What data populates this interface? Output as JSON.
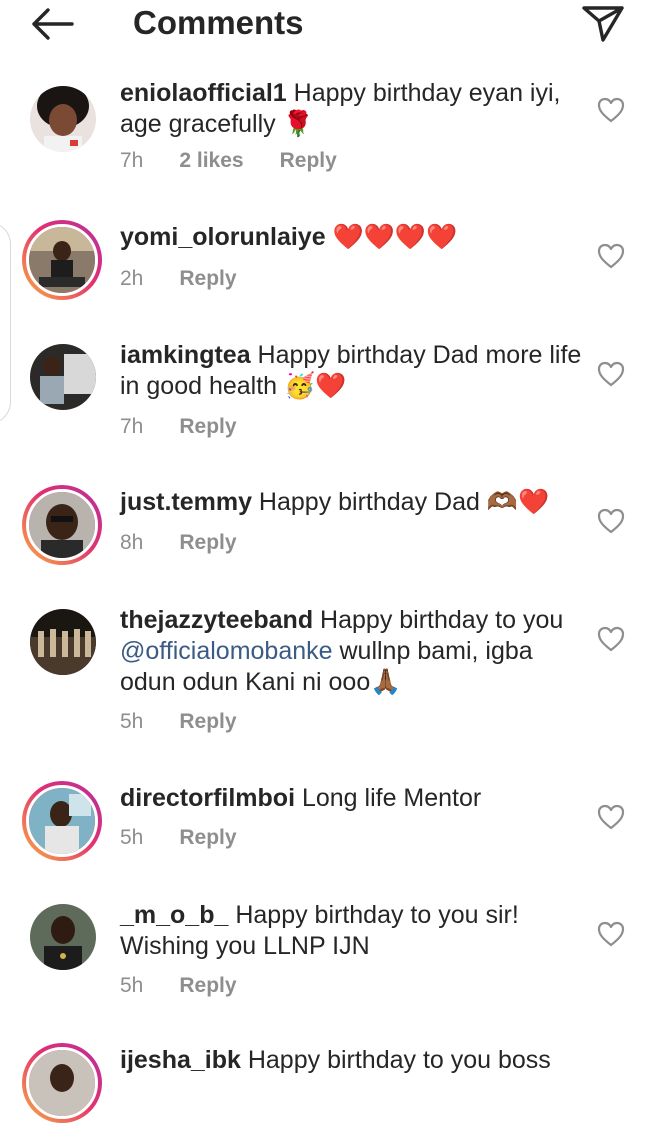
{
  "header": {
    "title": "Comments",
    "back_icon": "arrow-left-icon",
    "send_icon": "paper-plane-icon"
  },
  "comments": [
    {
      "username": "eniolaofficial1",
      "text": " Happy birthday eyan iyi, age gracefully 🌹",
      "time": "7h",
      "likes": "2 likes",
      "reply": "Reply",
      "story_ring": false
    },
    {
      "username": "yomi_olorunlaiye",
      "text": " ❤️❤️❤️❤️",
      "time": "2h",
      "reply": "Reply",
      "story_ring": true
    },
    {
      "username": "iamkingtea",
      "text": " Happy birthday Dad more life in good health 🥳❤️",
      "time": "7h",
      "reply": "Reply",
      "story_ring": false
    },
    {
      "username": "just.temmy",
      "text": " Happy birthday Dad 🫶🏾❤️",
      "time": "8h",
      "reply": "Reply",
      "story_ring": true
    },
    {
      "username": "thejazzyteeband",
      "text": " Happy birthday to you ",
      "mention": "@officialomobanke",
      "text_after": " wullnp bami, igba odun odun Kani ni ooo🙏🏾",
      "time": "5h",
      "reply": "Reply",
      "story_ring": false
    },
    {
      "username": "directorfilmboi",
      "text": " Long life Mentor",
      "time": "5h",
      "reply": "Reply",
      "story_ring": true
    },
    {
      "username": "_m_o_b_",
      "text": " Happy birthday to you sir! Wishing you LLNP IJN",
      "time": "5h",
      "reply": "Reply",
      "story_ring": false
    },
    {
      "username": "ijesha_ibk",
      "text": " Happy birthday to you boss",
      "story_ring": true
    }
  ],
  "colors": {
    "text": "#262626",
    "meta": "#8e8e8e",
    "mention": "#3b5b85",
    "ring_gradient": [
      "#f9b043",
      "#e2316f",
      "#b42fa3"
    ]
  }
}
